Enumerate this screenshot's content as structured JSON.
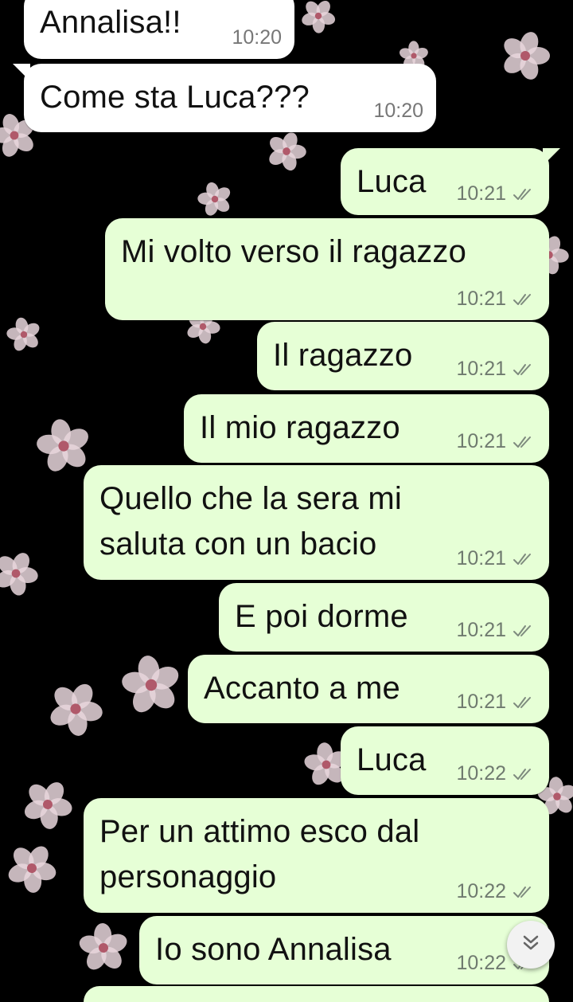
{
  "colors": {
    "incoming_bubble": "#ffffff",
    "outgoing_bubble": "#e6ffd6",
    "wallpaper": "#000000",
    "petals": "#e8d6dc",
    "ticks": "#7e8b7e"
  },
  "icons": {
    "read_receipt": "double-check-icon",
    "scroll_down": "double-chevron-down-icon",
    "wallpaper": "cherry-blossom-pattern"
  },
  "messages": [
    {
      "dir": "in",
      "lines": [
        "Annalisa!!"
      ],
      "time": "10:20"
    },
    {
      "dir": "in",
      "lines": [
        "Come sta Luca???"
      ],
      "time": "10:20"
    },
    {
      "dir": "out",
      "lines": [
        "Luca"
      ],
      "time": "10:21"
    },
    {
      "dir": "out",
      "lines": [
        "Mi volto verso il ragazzo"
      ],
      "time": "10:21"
    },
    {
      "dir": "out",
      "lines": [
        "Il ragazzo"
      ],
      "time": "10:21"
    },
    {
      "dir": "out",
      "lines": [
        "Il mio ragazzo"
      ],
      "time": "10:21"
    },
    {
      "dir": "out",
      "lines": [
        "Quello che la sera mi",
        "saluta con un bacio"
      ],
      "time": "10:21"
    },
    {
      "dir": "out",
      "lines": [
        "E poi dorme"
      ],
      "time": "10:21"
    },
    {
      "dir": "out",
      "lines": [
        "Accanto a me"
      ],
      "time": "10:21"
    },
    {
      "dir": "out",
      "lines": [
        "Luca"
      ],
      "time": "10:22"
    },
    {
      "dir": "out",
      "lines": [
        "Per un attimo esco dal",
        "personaggio"
      ],
      "time": "10:22"
    },
    {
      "dir": "out",
      "lines": [
        "Io sono Annalisa"
      ],
      "time": "10:22"
    }
  ]
}
